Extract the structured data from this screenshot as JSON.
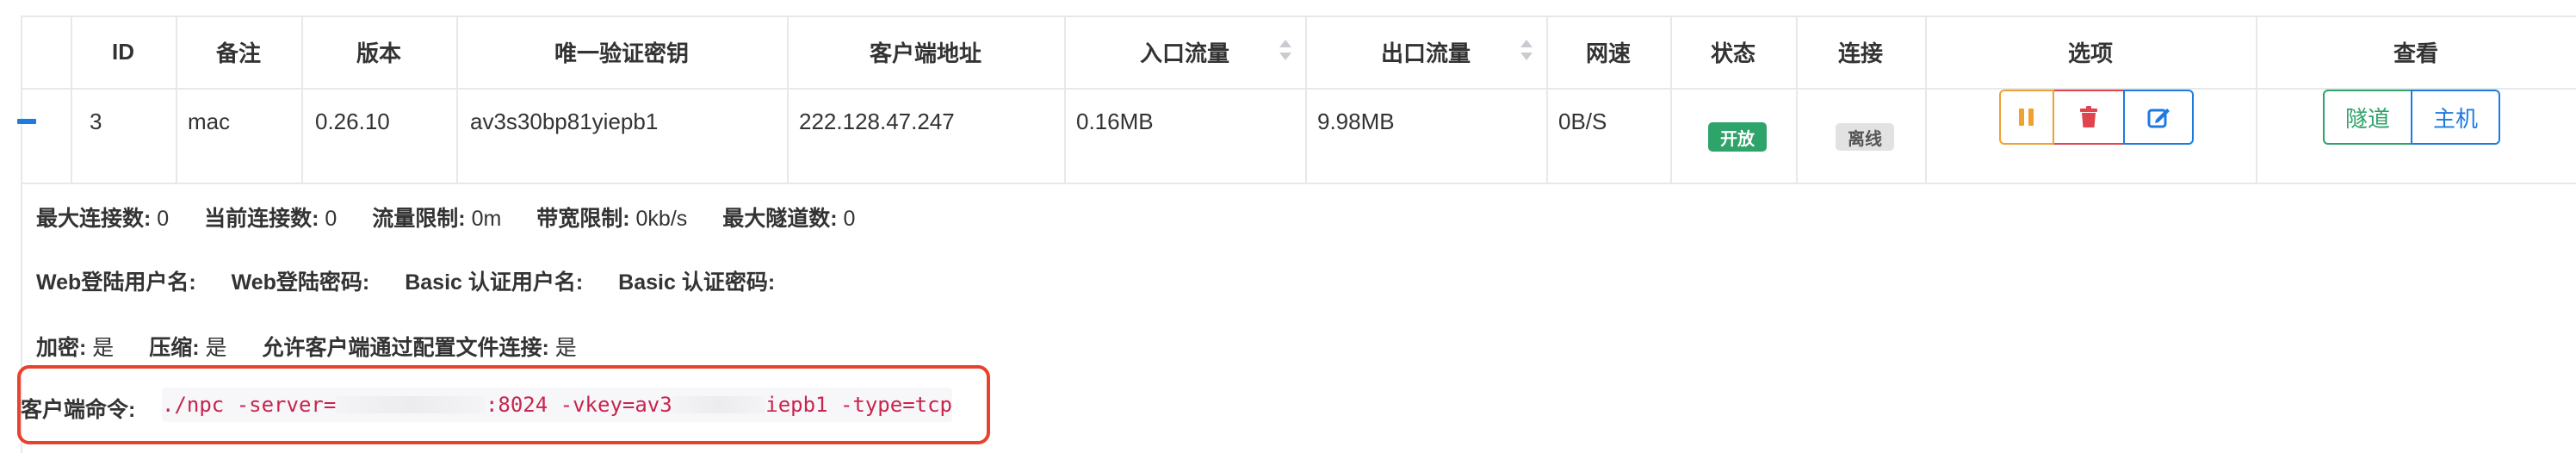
{
  "colors": {
    "header_line": "#e6e9ec",
    "primary": "#1f7ae0",
    "warning": "#f0a030",
    "danger": "#e0444d",
    "success_badge": "#2ea36a",
    "offline_badge": "#e2e2e2",
    "highlight_border": "#e8412c",
    "code_text": "#c7254e"
  },
  "table": {
    "columns": [
      "ID",
      "备注",
      "版本",
      "唯一验证密钥",
      "客户端地址",
      "入口流量",
      "出口流量",
      "网速",
      "状态",
      "连接",
      "选项",
      "查看"
    ],
    "row": {
      "id": "3",
      "remark": "mac",
      "version": "0.26.10",
      "vkey": "av3s30bp81yiepb1",
      "client_addr": "222.128.47.247",
      "inlet_flow": "0.16MB",
      "export_flow": "9.98MB",
      "speed": "0B/S",
      "status": "开放",
      "connection": "离线",
      "view_buttons": [
        "隧道",
        "主机"
      ]
    }
  },
  "detail": {
    "max_conn_label": "最大连接数:",
    "max_conn_value": "0",
    "cur_conn_label": "当前连接数:",
    "cur_conn_value": "0",
    "flow_limit_label": "流量限制:",
    "flow_limit_value": "0m",
    "rate_limit_label": "带宽限制:",
    "rate_limit_value": "0kb/s",
    "max_tunnel_label": "最大隧道数:",
    "max_tunnel_value": "0",
    "web_user_label": "Web登陆用户名:",
    "web_pass_label": "Web登陆密码:",
    "basic_user_label": "Basic 认证用户名:",
    "basic_pass_label": "Basic 认证密码:",
    "crypt_label": "加密:",
    "crypt_value": "是",
    "compress_label": "压缩:",
    "compress_value": "是",
    "config_conn_label": "允许客户端通过配置文件连接:",
    "config_conn_value": "是",
    "command_label": "客户端命令:",
    "command_part1": "./npc -server=",
    "command_part2": ":8024 -vkey=av3",
    "command_part3": "iepb1 -type=tcp"
  },
  "icons": {
    "collapse": "minus-icon",
    "pause": "pause-icon",
    "delete": "trash-icon",
    "edit": "edit-icon"
  }
}
